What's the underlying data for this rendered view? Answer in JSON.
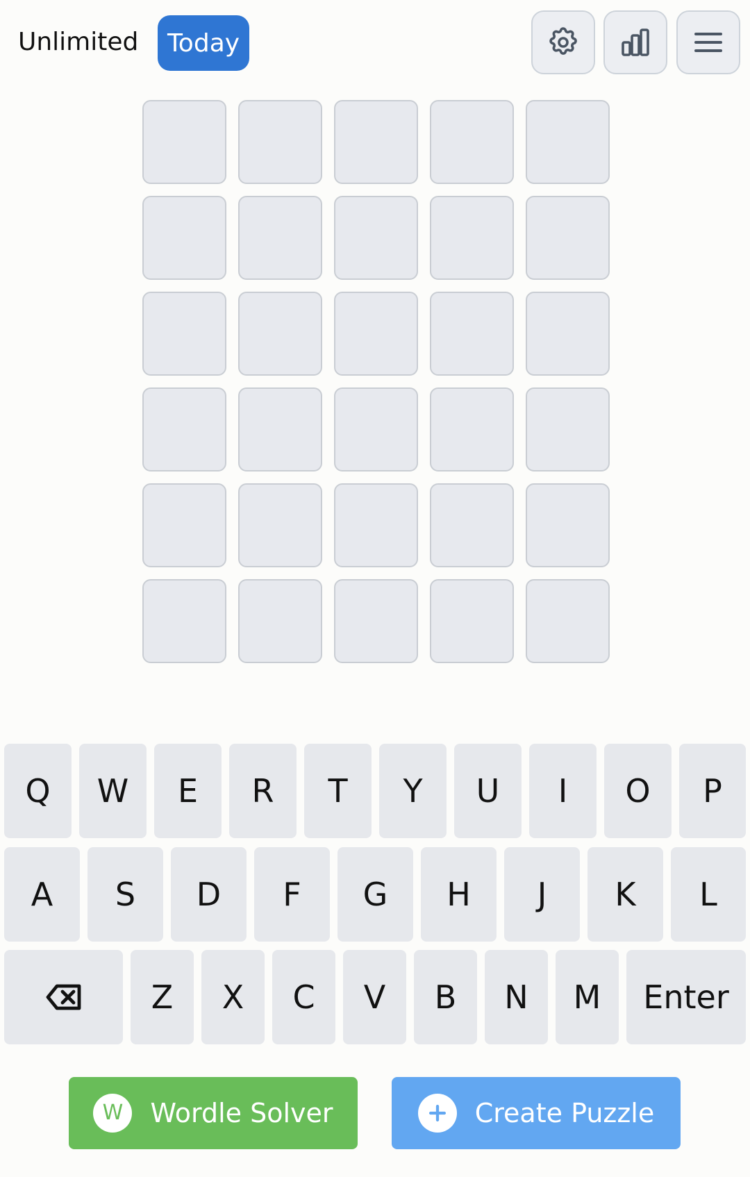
{
  "header": {
    "mode_unlimited": "Unlimited",
    "mode_today": "Today",
    "icons": [
      "gear-icon",
      "bar-chart-icon",
      "hamburger-menu-icon"
    ]
  },
  "board": {
    "rows": [
      [
        "",
        "",
        "",
        "",
        ""
      ],
      [
        "",
        "",
        "",
        "",
        ""
      ],
      [
        "",
        "",
        "",
        "",
        ""
      ],
      [
        "",
        "",
        "",
        "",
        ""
      ],
      [
        "",
        "",
        "",
        "",
        ""
      ],
      [
        "",
        "",
        "",
        "",
        ""
      ]
    ]
  },
  "keyboard": {
    "row1": [
      "Q",
      "W",
      "E",
      "R",
      "T",
      "Y",
      "U",
      "I",
      "O",
      "P"
    ],
    "row2": [
      "A",
      "S",
      "D",
      "F",
      "G",
      "H",
      "J",
      "K",
      "L"
    ],
    "row3": [
      "backspace-icon",
      "Z",
      "X",
      "C",
      "V",
      "B",
      "N",
      "M",
      "Enter"
    ]
  },
  "bottom": {
    "solver_label": "Wordle Solver",
    "solver_icon_letter": "W",
    "create_label": "Create Puzzle"
  },
  "colors": {
    "today_blue": "#2F76D3",
    "solver_green": "#69BD59",
    "create_blue": "#62A7F1",
    "tile_bg": "#E7E9EE",
    "key_bg": "#E6E8EC"
  }
}
